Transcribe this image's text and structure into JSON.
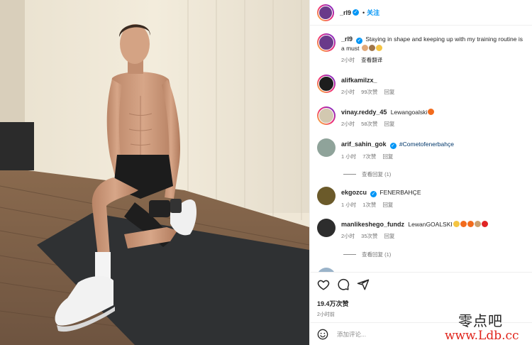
{
  "post": {
    "username": "_rl9",
    "follow": "关注",
    "caption": "Staying in shape and keeping up with my training routine is a must",
    "caption_time": "2小时",
    "translate": "查看翻译"
  },
  "comments": [
    {
      "user": "alifkamilzx_",
      "text": "",
      "time": "2小时",
      "likes": "99次赞",
      "reply": "回复"
    },
    {
      "user": "vinay.reddy_45",
      "text": "Lewangoalski",
      "time": "2小时",
      "likes": "58次赞",
      "reply": "回复"
    },
    {
      "user": "arif_sahin_gok",
      "text": "#Cometofenerbahçe",
      "time": "1 小时",
      "likes": "7次赞",
      "reply": "回复",
      "view_replies": "查看回复 (1)"
    },
    {
      "user": "ekgozcu",
      "text": "FENERBAHÇE",
      "time": "1 小时",
      "likes": "1次赞",
      "reply": "回复"
    },
    {
      "user": "manlikeshego_fundz",
      "text": "LewanGOALSKI",
      "time": "2小时",
      "likes": "35次赞",
      "reply": "回复",
      "view_replies": "查看回复 (1)"
    }
  ],
  "footer": {
    "likes_count": "19.4万次赞",
    "post_time": "2小时前",
    "add_comment_placeholder": "添加评论..."
  },
  "icons": [
    "heart-icon",
    "comment-icon",
    "share-icon",
    "emoji-icon",
    "verified-badge-icon"
  ],
  "watermark": {
    "line1": "零点吧",
    "line2": "www.Ldb.cc"
  },
  "colors": {
    "accent": "#0095f6",
    "meta": "#737373",
    "watermark_red": "#e0241b"
  }
}
